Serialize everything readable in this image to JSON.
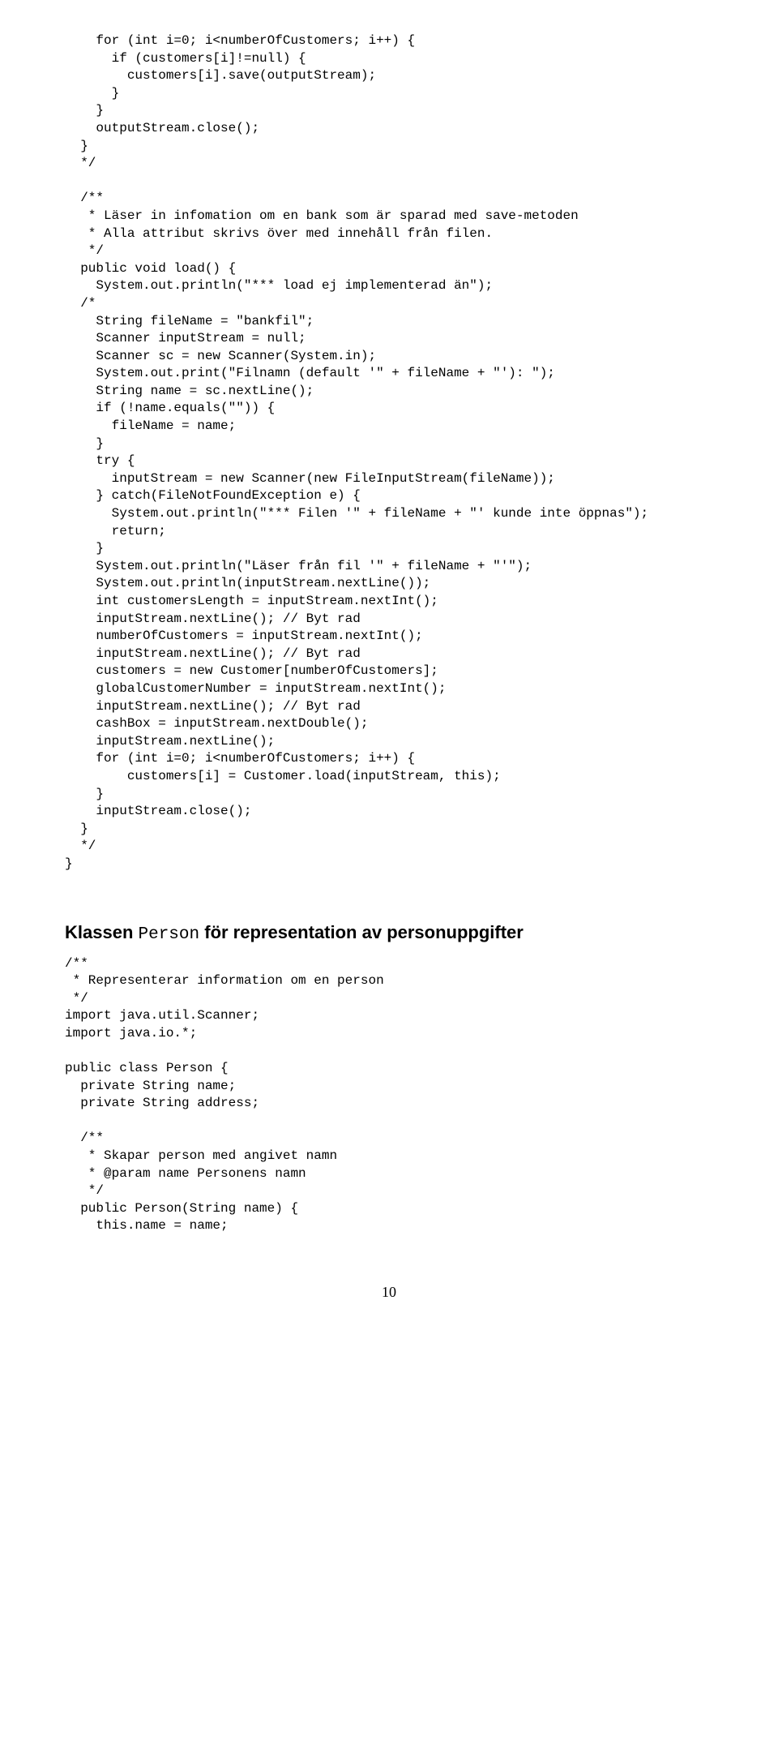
{
  "code_block_1": "    for (int i=0; i<numberOfCustomers; i++) {\n      if (customers[i]!=null) {\n        customers[i].save(outputStream);\n      }\n    }\n    outputStream.close();\n  }\n  */\n\n  /**\n   * Läser in infomation om en bank som är sparad med save-metoden\n   * Alla attribut skrivs över med innehåll från filen.\n   */\n  public void load() {\n    System.out.println(\"*** load ej implementerad än\");\n  /*\n    String fileName = \"bankfil\";\n    Scanner inputStream = null;\n    Scanner sc = new Scanner(System.in);\n    System.out.print(\"Filnamn (default '\" + fileName + \"'): \");\n    String name = sc.nextLine();\n    if (!name.equals(\"\")) {\n      fileName = name;\n    }\n    try {\n      inputStream = new Scanner(new FileInputStream(fileName));\n    } catch(FileNotFoundException e) {\n      System.out.println(\"*** Filen '\" + fileName + \"' kunde inte öppnas\");\n      return;\n    }\n    System.out.println(\"Läser från fil '\" + fileName + \"'\");\n    System.out.println(inputStream.nextLine());\n    int customersLength = inputStream.nextInt();\n    inputStream.nextLine(); // Byt rad\n    numberOfCustomers = inputStream.nextInt();\n    inputStream.nextLine(); // Byt rad\n    customers = new Customer[numberOfCustomers];\n    globalCustomerNumber = inputStream.nextInt();\n    inputStream.nextLine(); // Byt rad\n    cashBox = inputStream.nextDouble();\n    inputStream.nextLine();\n    for (int i=0; i<numberOfCustomers; i++) {\n        customers[i] = Customer.load(inputStream, this);\n    }\n    inputStream.close();\n  }\n  */\n}",
  "section_heading_prefix": "Klassen ",
  "section_heading_mono": "Person",
  "section_heading_suffix": " för representation av personuppgifter",
  "code_block_2": "/**\n * Representerar information om en person\n */\nimport java.util.Scanner;\nimport java.io.*;\n\npublic class Person {\n  private String name;\n  private String address;\n\n  /**\n   * Skapar person med angivet namn\n   * @param name Personens namn\n   */\n  public Person(String name) {\n    this.name = name;",
  "page_number": "10"
}
